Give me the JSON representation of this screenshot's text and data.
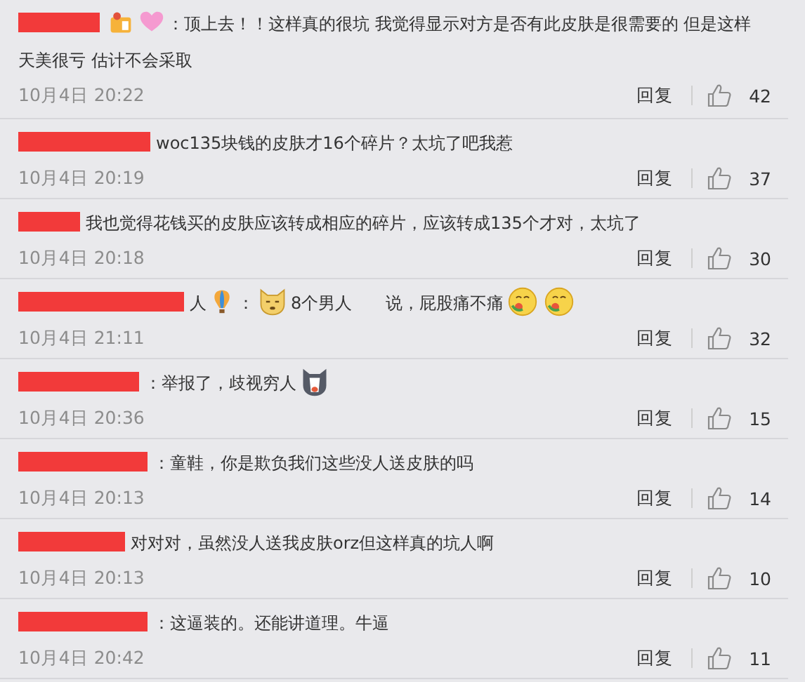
{
  "comments": [
    {
      "content": [
        {
          "kind": "redacted"
        },
        {
          "kind": "badge"
        },
        {
          "kind": "heart"
        },
        {
          "kind": "text",
          "text": "：顶上去！！这样真的很坑 我觉得显示对方是否有此皮肤是很需要的 但是这样"
        },
        {
          "kind": "text",
          "text": "天美很亏 估计不会采取"
        }
      ],
      "date": "10月4日 20:22",
      "reply": "回复",
      "likes": "42"
    },
    {
      "content": [
        {
          "kind": "redacted"
        },
        {
          "kind": "text",
          "text": "woc135块钱的皮肤才16个碎片？太坑了吧我惹"
        }
      ],
      "date": "10月4日 20:19",
      "reply": "回复",
      "likes": "37"
    },
    {
      "content": [
        {
          "kind": "redacted"
        },
        {
          "kind": "text",
          "text": "我也觉得花钱买的皮肤应该转成相应的碎片，应该转成135个才对，太坑了"
        }
      ],
      "date": "10月4日 20:18",
      "reply": "回复",
      "likes": "30"
    },
    {
      "content": [
        {
          "kind": "redacted"
        },
        {
          "kind": "text",
          "text": "人"
        },
        {
          "kind": "balloon"
        },
        {
          "kind": "text",
          "text": "："
        },
        {
          "kind": "dog"
        },
        {
          "kind": "text",
          "text": "8个男人　　说，屁股痛不痛"
        },
        {
          "kind": "yum"
        },
        {
          "kind": "yum"
        }
      ],
      "date": "10月4日 21:11",
      "reply": "回复",
      "likes": "32"
    },
    {
      "content": [
        {
          "kind": "redacted"
        },
        {
          "kind": "text",
          "text": "：举报了，歧视穷人"
        },
        {
          "kind": "husky"
        }
      ],
      "date": "10月4日 20:36",
      "reply": "回复",
      "likes": "15"
    },
    {
      "content": [
        {
          "kind": "redacted"
        },
        {
          "kind": "text",
          "text": "：童鞋，你是欺负我们这些没人送皮肤的吗"
        }
      ],
      "date": "10月4日 20:13",
      "reply": "回复",
      "likes": "14"
    },
    {
      "content": [
        {
          "kind": "redacted"
        },
        {
          "kind": "text",
          "text": "对对对，虽然没人送我皮肤orz但这样真的坑人啊"
        }
      ],
      "date": "10月4日 20:13",
      "reply": "回复",
      "likes": "10"
    },
    {
      "content": [
        {
          "kind": "redacted"
        },
        {
          "kind": "text",
          "text": "：这逼装的。还能讲道理。牛逼"
        }
      ],
      "date": "10月4日 20:42",
      "reply": "回复",
      "likes": "11"
    }
  ]
}
